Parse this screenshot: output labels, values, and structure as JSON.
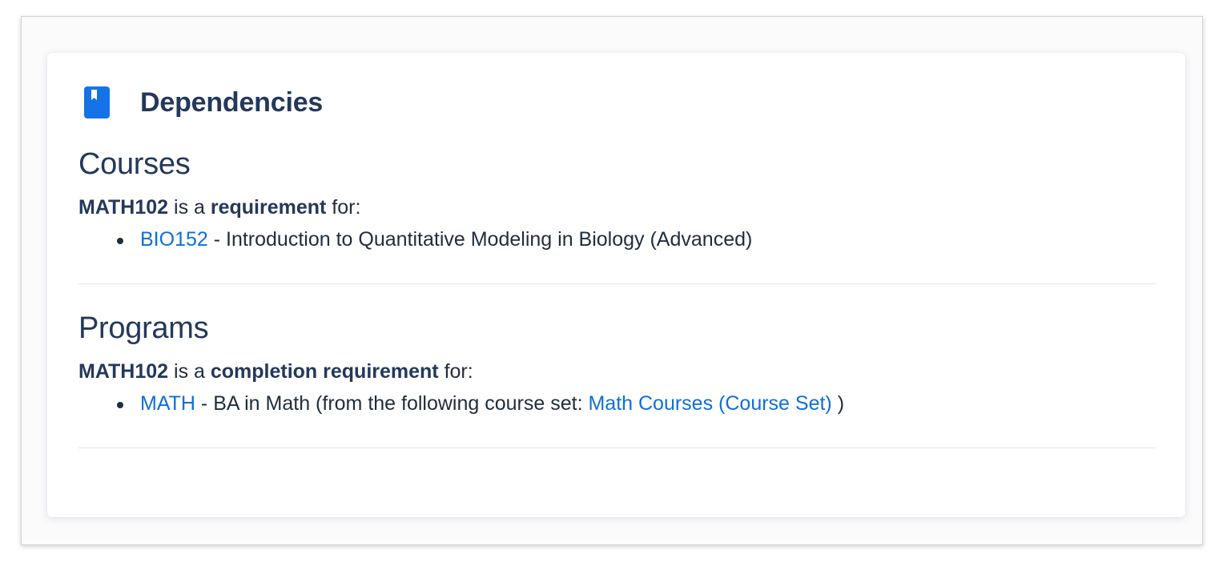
{
  "card": {
    "title": "Dependencies",
    "icon": "book-icon",
    "accent_color": "#1473e6"
  },
  "courses": {
    "heading": "Courses",
    "lead_code": "MATH102",
    "lead_mid": " is a ",
    "lead_bold": "requirement",
    "lead_end": " for:",
    "items": [
      {
        "code": "BIO152",
        "description": " - Introduction to Quantitative Modeling in Biology (Advanced)"
      }
    ]
  },
  "programs": {
    "heading": "Programs",
    "lead_code": "MATH102",
    "lead_mid": " is a ",
    "lead_bold": "completion requirement",
    "lead_end": " for:",
    "items": [
      {
        "code": "MATH",
        "description": " - BA in Math (from the following course set: ",
        "course_set": "Math Courses (Course Set)",
        "suffix": " )"
      }
    ]
  }
}
